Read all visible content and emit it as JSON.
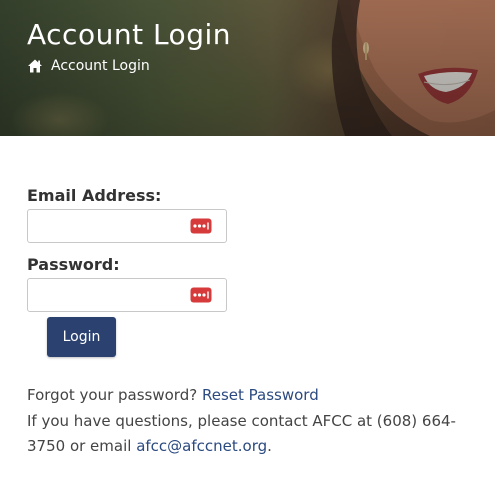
{
  "header": {
    "title": "Account Login",
    "breadcrumb": {
      "icon": "home-icon",
      "label": "Account Login"
    }
  },
  "form": {
    "email": {
      "label": "Email Address:",
      "value": "",
      "placeholder": "",
      "icon": "password-manager-icon"
    },
    "password": {
      "label": "Password:",
      "value": "",
      "placeholder": "",
      "icon": "password-manager-icon"
    },
    "submit_label": "Login"
  },
  "help": {
    "forgot_text": "Forgot your password?",
    "reset_link": "Reset Password",
    "contact_text": "If you have questions, please contact AFCC at (608) 664-3750 or email",
    "email_link": "afcc@afccnet.org",
    "trailing": "."
  },
  "colors": {
    "button_bg": "#2b4270",
    "link": "#2b4a80",
    "key_icon": "#d63a3a"
  }
}
